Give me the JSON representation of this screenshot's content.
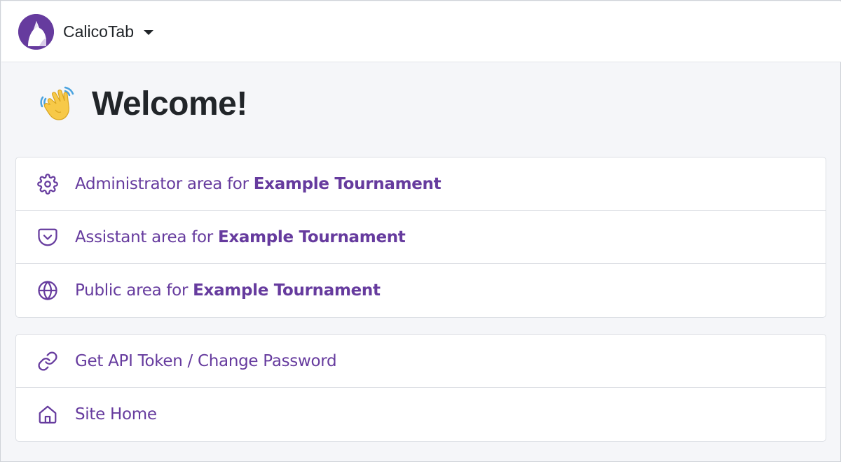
{
  "navbar": {
    "brand_name": "CalicoTab"
  },
  "header": {
    "title": "Welcome!"
  },
  "areas": {
    "items": [
      {
        "icon": "gear-icon",
        "prefix": "Administrator area for",
        "tournament": "Example Tournament"
      },
      {
        "icon": "pocket-icon",
        "prefix": "Assistant area for",
        "tournament": "Example Tournament"
      },
      {
        "icon": "globe-icon",
        "prefix": "Public area for",
        "tournament": "Example Tournament"
      }
    ]
  },
  "account": {
    "items": [
      {
        "icon": "link-icon",
        "label": "Get API Token / Change Password"
      },
      {
        "icon": "home-icon",
        "label": "Site Home"
      }
    ]
  },
  "colors": {
    "accent": "#663b9e",
    "text": "#212529",
    "background": "#f5f6f9"
  }
}
